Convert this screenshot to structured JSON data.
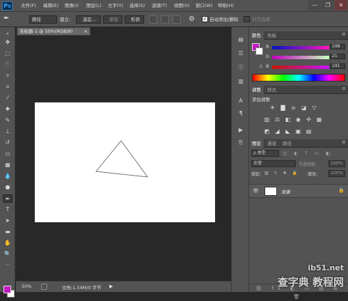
{
  "app": {
    "logo": "Ps"
  },
  "menu": [
    "文件(F)",
    "编辑(E)",
    "图像(I)",
    "图层(L)",
    "文字(Y)",
    "选择(S)",
    "滤镜(T)",
    "视图(V)",
    "窗口(W)",
    "帮助(H)"
  ],
  "window_controls": {
    "minimize": "—",
    "restore": "❐",
    "close": "✕"
  },
  "options": {
    "mode": "路径",
    "build_label": "建立:",
    "selection_btn": "选区...",
    "mask_btn": "蒙版",
    "shape_btn": "形状",
    "auto_add_label": "自动添加/删除",
    "align_edges_label": "对齐边缘",
    "auto_add_checked": true
  },
  "document": {
    "tab_title": "未标题-1 @ 50%(RGB/8)",
    "zoom": "50%",
    "doc_info": "文档:1.54M/0 字节"
  },
  "colors": {
    "fg": "#c41ac4",
    "bg": "#ffffff",
    "accent": "#c41ac4"
  },
  "color_panel": {
    "tabs": [
      "颜色",
      "色板"
    ],
    "r_label": "R",
    "g_label": "G",
    "b_label": "B",
    "r": "198",
    "g": "21",
    "b": "191"
  },
  "adjust_panel": {
    "tabs": [
      "调整",
      "样式"
    ],
    "title": "添加调整"
  },
  "layers_panel": {
    "tabs": [
      "图层",
      "通道",
      "路径"
    ],
    "kind": "ρ 类型",
    "blend": "正常",
    "opacity_label": "不透明度:",
    "opacity": "100%",
    "lock_label": "锁定:",
    "fill_label": "填充:",
    "fill": "100%",
    "layer_name": "背景"
  },
  "watermark": {
    "line1": "ib51.net",
    "line2": "查字典 教程网"
  }
}
